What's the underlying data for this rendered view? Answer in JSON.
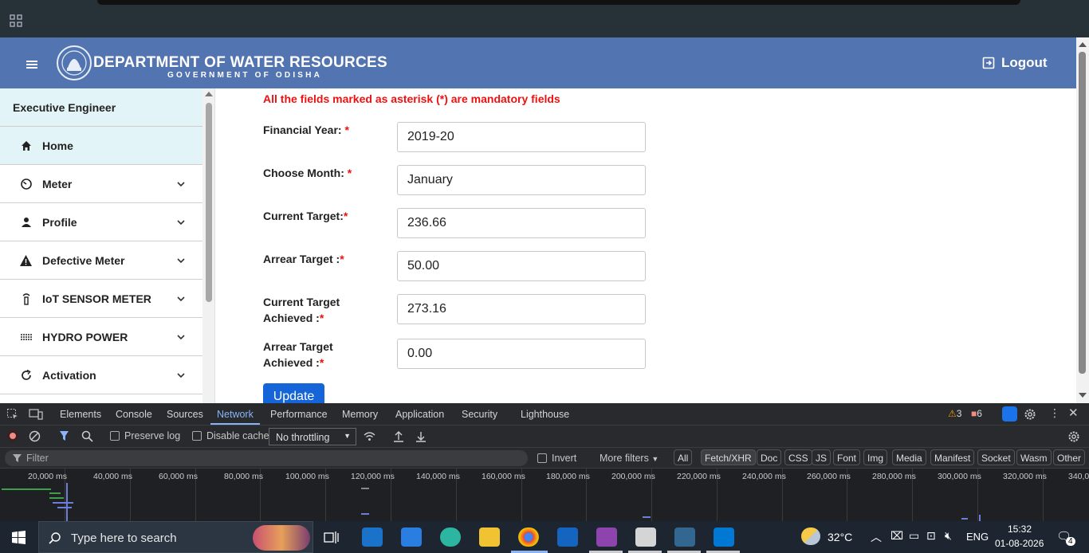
{
  "header": {
    "title": "DEPARTMENT OF WATER RESOURCES",
    "subtitle": "GOVERNMENT OF ODISHA",
    "logout_label": "Logout"
  },
  "sidebar": {
    "role": "Executive Engineer",
    "items": [
      {
        "label": "Home",
        "icon": "home-icon"
      },
      {
        "label": "Meter",
        "icon": "meter-icon"
      },
      {
        "label": "Profile",
        "icon": "person-icon"
      },
      {
        "label": "Defective Meter",
        "icon": "warning-icon"
      },
      {
        "label": "IoT SENSOR METER",
        "icon": "sensor-icon"
      },
      {
        "label": "HYDRO POWER",
        "icon": "waves-icon"
      },
      {
        "label": "Activation",
        "icon": "refresh-icon"
      }
    ]
  },
  "form": {
    "mandatory_note": "All the fields marked as asterisk (*) are mandatory fields",
    "fields": [
      {
        "label": "Financial Year: ",
        "star": "*",
        "value": "2019-20"
      },
      {
        "label": "Choose Month: ",
        "star": "*",
        "value": "January"
      },
      {
        "label": "Current Target:",
        "star": "*",
        "value": "236.66"
      },
      {
        "label": "Arrear Target :",
        "star": "*",
        "value": "50.00"
      },
      {
        "label": "Current Target Achieved :",
        "star": "*",
        "value": "273.16"
      },
      {
        "label": "Arrear Target Achieved :",
        "star": "*",
        "value": "0.00"
      }
    ],
    "update_label": "Update"
  },
  "devtools": {
    "tabs": [
      "Elements",
      "Console",
      "Sources",
      "Network",
      "Performance",
      "Memory",
      "Application",
      "Security",
      "Lighthouse"
    ],
    "active_tab": "Network",
    "warnings": "3",
    "errors": "6",
    "preserve_log": "Preserve log",
    "disable_cache": "Disable cache",
    "throttling": "No throttling",
    "filter_placeholder": "Filter",
    "invert": "Invert",
    "more_filters": "More filters",
    "type_filters": [
      "All",
      "Fetch/XHR",
      "Doc",
      "CSS",
      "JS",
      "Font",
      "Img",
      "Media",
      "Manifest",
      "Socket",
      "Wasm",
      "Other"
    ],
    "active_type_filter": "Fetch/XHR",
    "timeline_ticks": [
      "20,000 ms",
      "40,000 ms",
      "60,000 ms",
      "80,000 ms",
      "100,000 ms",
      "120,000 ms",
      "140,000 ms",
      "160,000 ms",
      "180,000 ms",
      "200,000 ms",
      "220,000 ms",
      "240,000 ms",
      "260,000 ms",
      "280,000 ms",
      "300,000 ms",
      "320,000 ms",
      "340,0"
    ]
  },
  "taskbar": {
    "search_placeholder": "Type here to search",
    "temperature": "32°C",
    "language": "ENG",
    "time": "15:32",
    "date": "01-08-2026",
    "notifications": "4"
  },
  "colors": {
    "header_bg": "#5274b1",
    "sidebar_active": "#e2f4f7",
    "mandatory_red": "#ee1111",
    "button_blue": "#1565d8",
    "devtools_accent": "#8ab4f8"
  }
}
